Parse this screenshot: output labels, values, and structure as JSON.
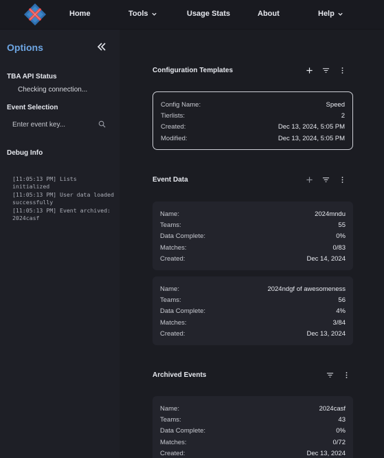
{
  "nav": {
    "items": [
      {
        "label": "Home",
        "dropdown": false
      },
      {
        "label": "Tools",
        "dropdown": true
      },
      {
        "label": "Usage Stats",
        "dropdown": false
      },
      {
        "label": "About",
        "dropdown": false
      },
      {
        "label": "Help",
        "dropdown": true
      }
    ]
  },
  "sidebar": {
    "title": "Options",
    "api_status_heading": "TBA API Status",
    "api_status_text": "Checking connection...",
    "event_selection_heading": "Event Selection",
    "event_search_placeholder": "Enter event key...",
    "debug_heading": "Debug Info",
    "debug_log": "[11:05:13 PM] Lists initialized\n[11:05:13 PM] User data loaded successfully\n[11:05:13 PM] Event archived: 2024casf"
  },
  "config_templates": {
    "title": "Configuration Templates",
    "card": {
      "rows": [
        {
          "k": "Config Name:",
          "v": "Speed"
        },
        {
          "k": "Tierlists:",
          "v": "2"
        },
        {
          "k": "Created:",
          "v": "Dec 13, 2024, 5:05 PM"
        },
        {
          "k": "Modified:",
          "v": "Dec 13, 2024, 5:05 PM"
        }
      ]
    }
  },
  "event_data": {
    "title": "Event Data",
    "cards": [
      {
        "rows": [
          {
            "k": "Name:",
            "v": "2024mndu"
          },
          {
            "k": "Teams:",
            "v": "55"
          },
          {
            "k": "Data Complete:",
            "v": "0%"
          },
          {
            "k": "Matches:",
            "v": "0/83"
          },
          {
            "k": "Created:",
            "v": "Dec 14, 2024"
          }
        ]
      },
      {
        "rows": [
          {
            "k": "Name:",
            "v": "2024ndgf of awesomeness"
          },
          {
            "k": "Teams:",
            "v": "56"
          },
          {
            "k": "Data Complete:",
            "v": "4%"
          },
          {
            "k": "Matches:",
            "v": "3/84"
          },
          {
            "k": "Created:",
            "v": "Dec 13, 2024"
          }
        ]
      }
    ]
  },
  "archived_events": {
    "title": "Archived Events",
    "cards": [
      {
        "rows": [
          {
            "k": "Name:",
            "v": "2024casf"
          },
          {
            "k": "Teams:",
            "v": "43"
          },
          {
            "k": "Data Complete:",
            "v": "0%"
          },
          {
            "k": "Matches:",
            "v": "0/72"
          },
          {
            "k": "Created:",
            "v": "Dec 13, 2024"
          }
        ]
      }
    ]
  },
  "colors": {
    "accent": "#6ea6e4",
    "background": "#1b1c22",
    "sidebar": "#1e1f26",
    "card": "#23242c"
  }
}
